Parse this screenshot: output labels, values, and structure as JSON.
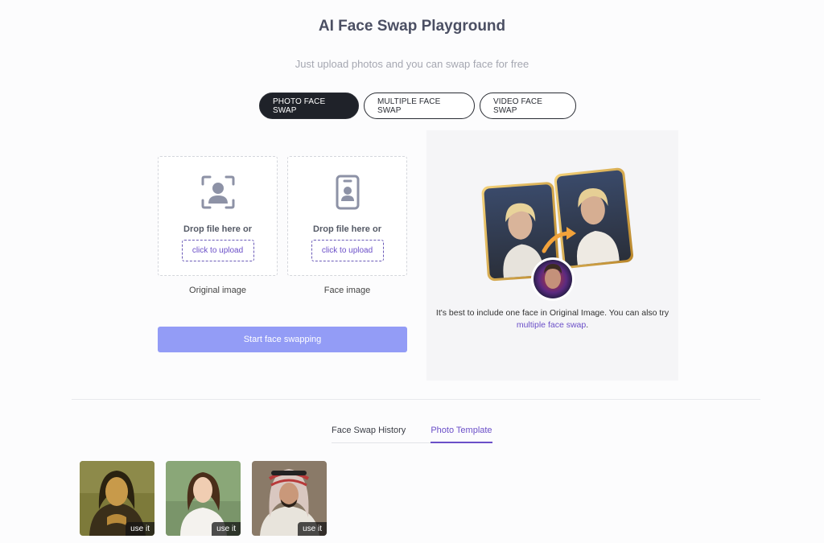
{
  "header": {
    "title": "AI Face Swap Playground",
    "subtitle": "Just upload photos and you can swap face for free"
  },
  "tabs": [
    {
      "label": "PHOTO FACE SWAP",
      "active": true
    },
    {
      "label": "MULTIPLE FACE SWAP",
      "active": false
    },
    {
      "label": "VIDEO FACE SWAP",
      "active": false
    }
  ],
  "upload": {
    "original": {
      "drop_text": "Drop file here or",
      "button": "click to upload",
      "label": "Original image",
      "icon": "face-scan-icon"
    },
    "face": {
      "drop_text": "Drop file here or",
      "button": "click to upload",
      "label": "Face image",
      "icon": "id-badge-icon"
    }
  },
  "start_button": "Start face swapping",
  "preview": {
    "caption": "It's best to include one face in Original Image. You can also try",
    "link": "multiple face swap",
    "link_suffix": "."
  },
  "bottom_tabs": [
    {
      "label": "Face Swap History",
      "active": false
    },
    {
      "label": "Photo Template",
      "active": true
    }
  ],
  "templates": [
    {
      "name": "mona-lisa",
      "action": "use it"
    },
    {
      "name": "woman-portrait",
      "action": "use it"
    },
    {
      "name": "man-keffiyeh",
      "action": "use it"
    }
  ],
  "colors": {
    "accent": "#6b4fc8",
    "start_button": "#939cf6",
    "active_tab": "#1f2229"
  }
}
